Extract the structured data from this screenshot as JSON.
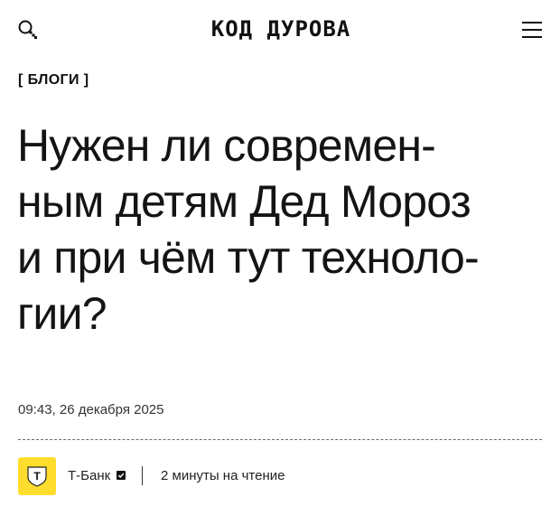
{
  "header": {
    "logo": "КОД ДУРОВА",
    "search_icon": "search-icon",
    "menu_icon": "hamburger-menu-icon"
  },
  "article": {
    "category": "[ БЛОГИ ]",
    "title_lines": [
      "Нужен ли современ-",
      "ным детям Дед Мороз",
      "и при чём тут техноло-",
      "гии?"
    ],
    "date": "09:43, 26 декабря 2025"
  },
  "author": {
    "name": "Т-Банк",
    "logo_letter": "Т",
    "brand_color": "#ffdd2d",
    "badge_icon": "verified-badge-icon",
    "read_time": "2 минуты на чтение"
  }
}
